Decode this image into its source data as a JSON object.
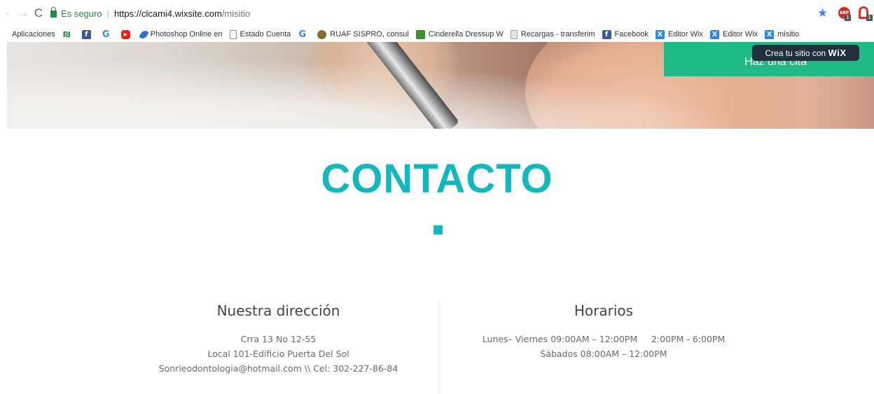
{
  "browser": {
    "secure_label": "Es seguro",
    "url_host": "https://clcami4.wixsite.com",
    "url_path": "/misitio",
    "ext_badge_1": "1",
    "ext_badge_2": "1",
    "ext_label_abp": "ABP"
  },
  "bookmarks": [
    {
      "label": "Aplicaciones",
      "icon": "apps-grid-icon"
    },
    {
      "label": "",
      "icon": "bank-icon"
    },
    {
      "label": "",
      "icon": "facebook-icon"
    },
    {
      "label": "",
      "icon": "google-icon"
    },
    {
      "label": "",
      "icon": "youtube-icon"
    },
    {
      "label": "Photoshop Online en",
      "icon": "photoshop-icon"
    },
    {
      "label": "Estado Cuenta",
      "icon": "document-icon"
    },
    {
      "label": "",
      "icon": "google-icon"
    },
    {
      "label": "RUAF SISPRO, consul",
      "icon": "seal-icon"
    },
    {
      "label": "Cinderella Dressup W",
      "icon": "game-icon"
    },
    {
      "label": "Recargas - transferim",
      "icon": "file-icon"
    },
    {
      "label": "Facebook",
      "icon": "facebook-icon"
    },
    {
      "label": "Editor Wix",
      "icon": "wix-icon"
    },
    {
      "label": "Editor Wix",
      "icon": "wix-icon"
    },
    {
      "label": "misitio",
      "icon": "wix-icon"
    }
  ],
  "hero": {
    "cta_label": "Haz una cita",
    "wix_tip_text": "Crea tu sitio con ",
    "wix_tip_brand": "WiX"
  },
  "contact": {
    "title": "CONTACTO",
    "address": {
      "heading": "Nuestra dirección",
      "line1": "Crra 13 No 12-55",
      "line2": "Local 101-Edificio Puerta Del Sol",
      "line3": "Sonrieodontologia@hotmail.com \\\\ Cel: 302-227-86-84"
    },
    "hours": {
      "heading": "Horarios",
      "line1": "Lunes– Viernes 09:00AM – 12:00PM     2:00PM - 6:00PM",
      "line2": "Sábados 08:00AM – 12:00PM"
    }
  },
  "colors": {
    "accent": "#12b8bd",
    "cta_green": "#1fba86",
    "secure_green": "#1e8e3e"
  }
}
